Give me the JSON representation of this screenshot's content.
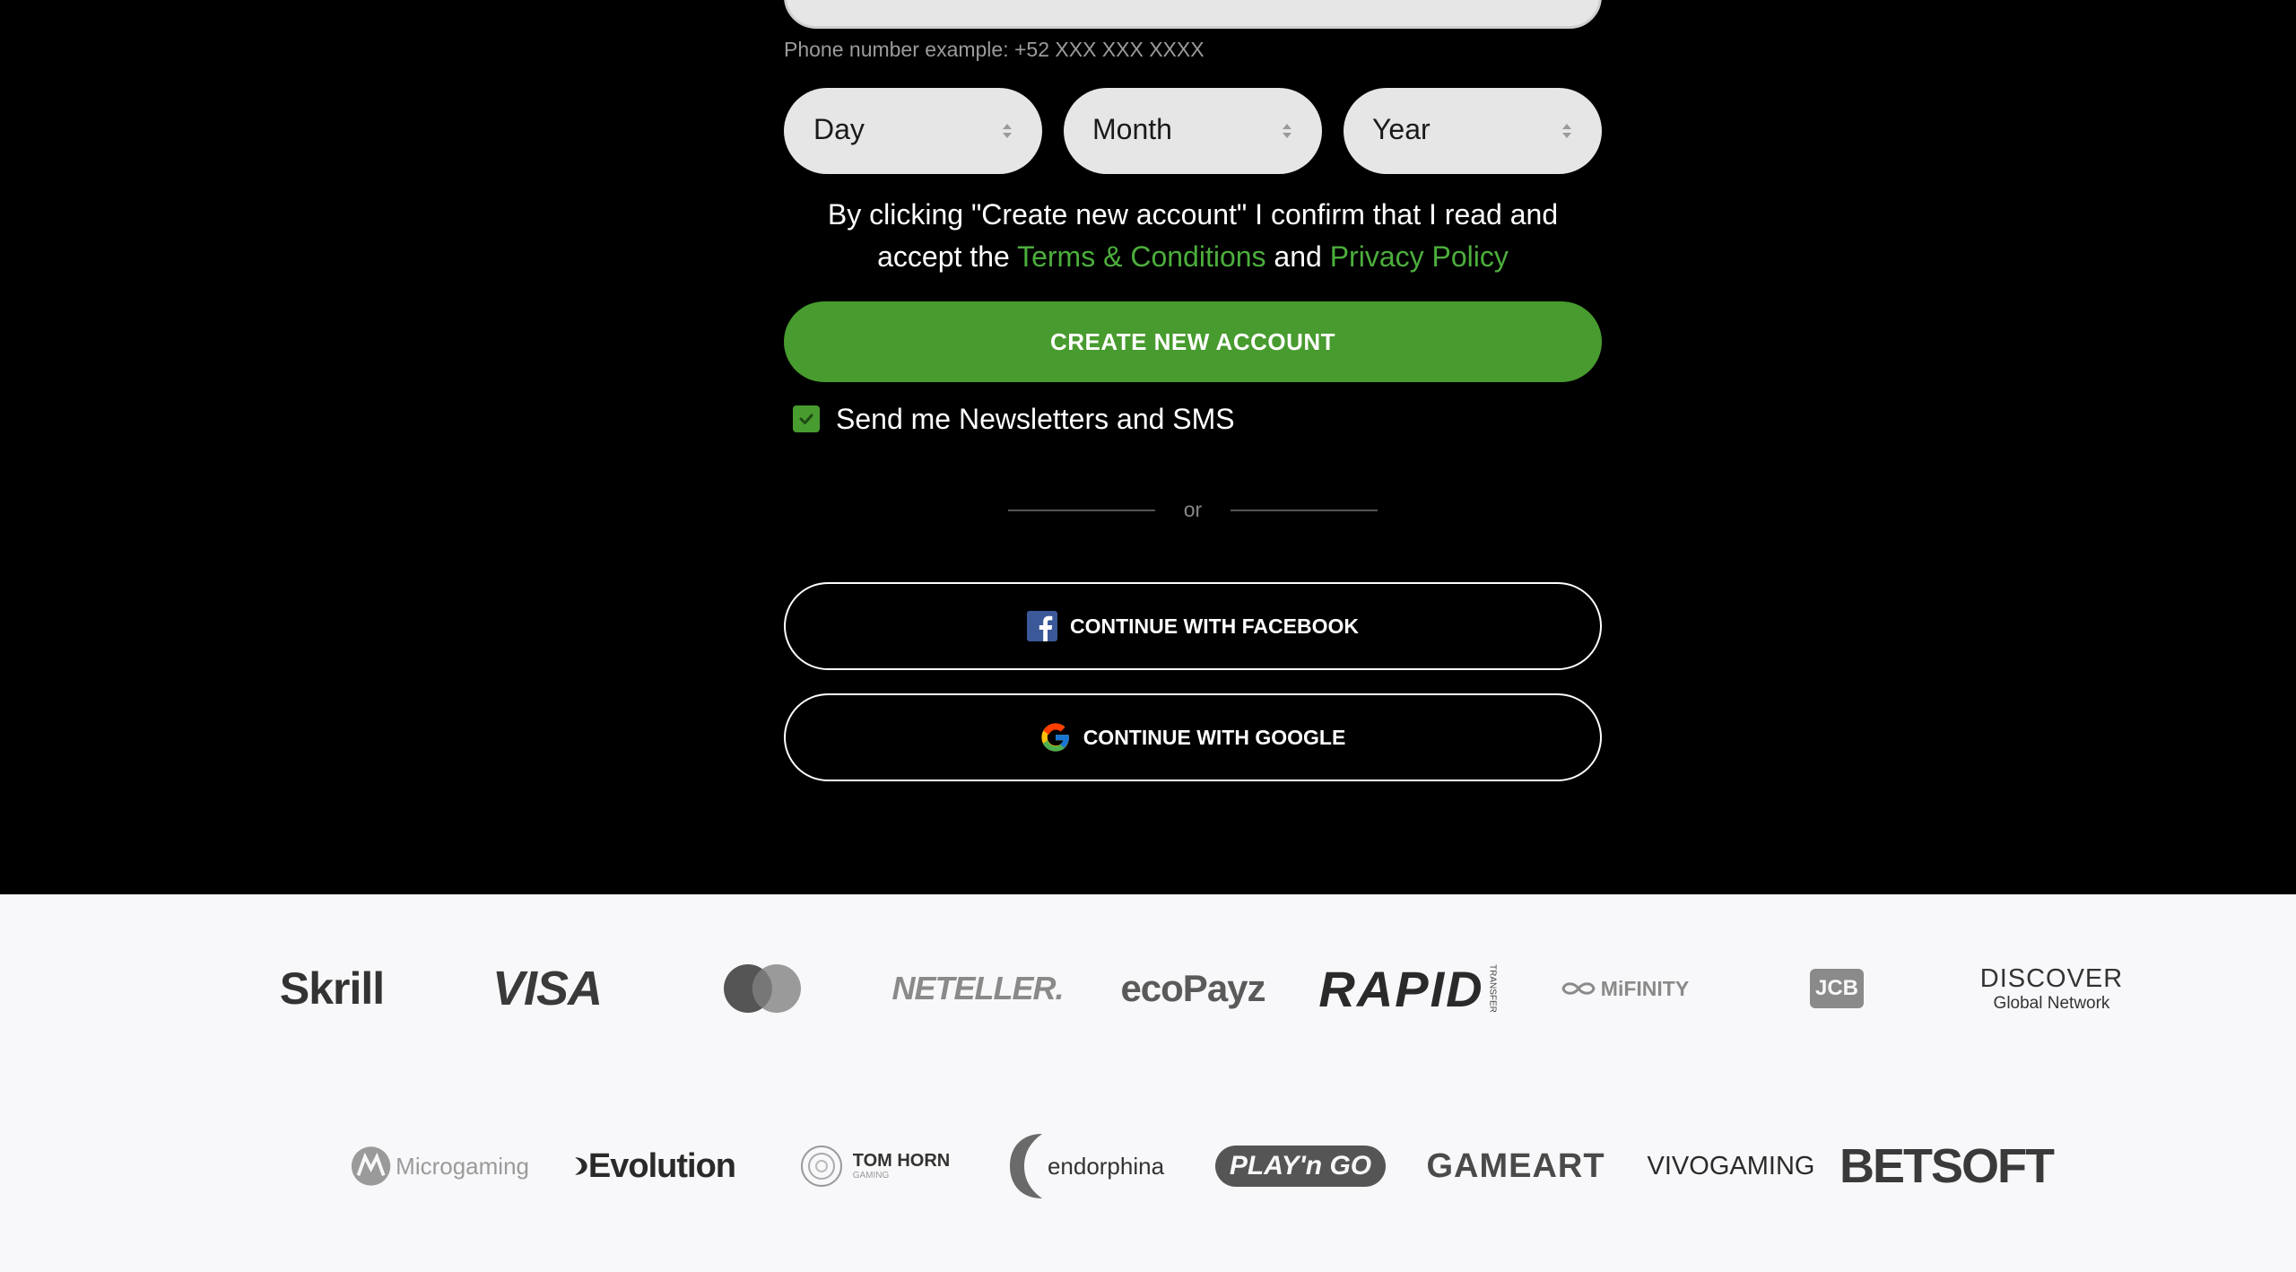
{
  "form": {
    "phone_hint": "Phone number example: +52 XXX XXX XXXX",
    "day_label": "Day",
    "month_label": "Month",
    "year_label": "Year",
    "consent_prefix": "By clicking \"Create new account\" I confirm that I read and accept the ",
    "terms_link": "Terms & Conditions",
    "consent_and": " and ",
    "privacy_link": "Privacy Policy",
    "create_button": "CREATE NEW ACCOUNT",
    "newsletter_label": "Send me Newsletters and SMS",
    "newsletter_checked": true,
    "divider_text": "or",
    "facebook_button": "CONTINUE WITH FACEBOOK",
    "google_button": "CONTINUE WITH GOOGLE"
  },
  "payment_logos": {
    "skrill": "Skrill",
    "visa": "VISA",
    "mastercard": "mastercard",
    "neteller": "NETELLER.",
    "ecopayz": "ecoPayz",
    "rapid": "RAPID",
    "rapid_sub": "TRANSFER",
    "mifinity": "MiFINITY",
    "jcb": "JCB",
    "discover": "DISCOVER",
    "discover_sub": "Global Network"
  },
  "provider_logos": {
    "microgaming": "Microgaming",
    "evolution": "Evolution",
    "tomhorn": "TOM HORN",
    "tomhorn_sub": "GAMING",
    "endorphina": "endorphina",
    "playngo": "PLAY'n GO",
    "gameart": "GAMEART",
    "vivogaming": "VIVOGAMING",
    "betsoft": "BETSOFT"
  },
  "colors": {
    "accent_green": "#489b2e",
    "link_green": "#4cae3c",
    "background": "#000000",
    "logos_background": "#f8f8fa"
  }
}
